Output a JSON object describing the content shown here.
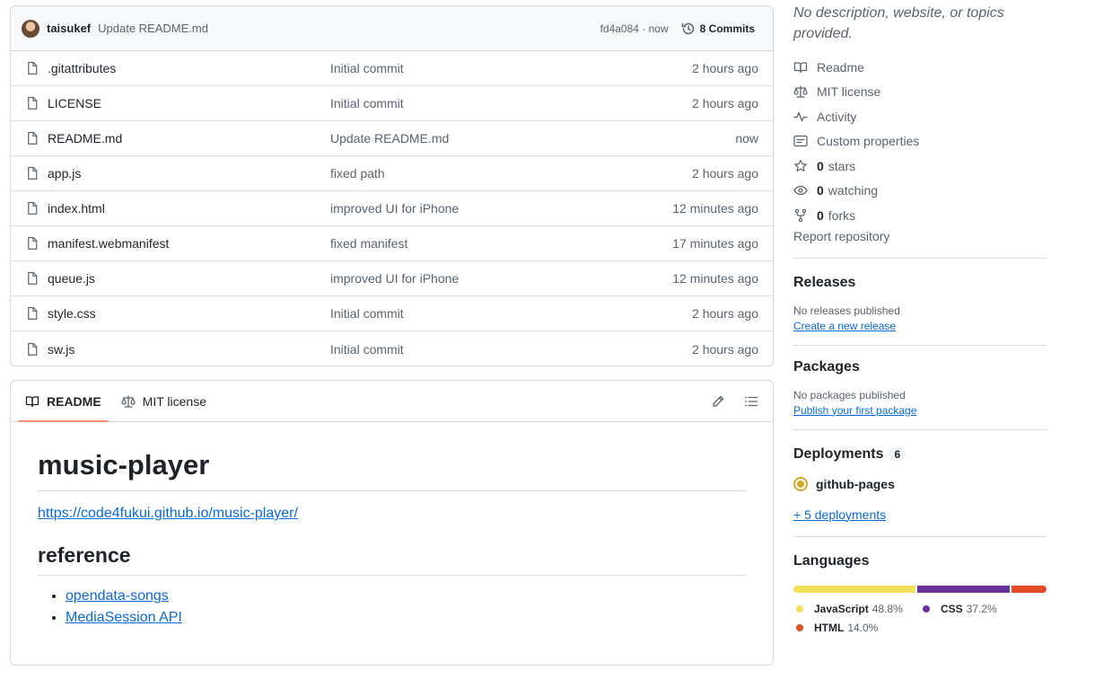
{
  "commit": {
    "author": "taisukef",
    "message": "Update README.md",
    "sha_time": "fd4a084 · now",
    "count_label": "8 Commits"
  },
  "files": [
    {
      "name": ".gitattributes",
      "commit": "Initial commit",
      "age": "2 hours ago"
    },
    {
      "name": "LICENSE",
      "commit": "Initial commit",
      "age": "2 hours ago"
    },
    {
      "name": "README.md",
      "commit": "Update README.md",
      "age": "now"
    },
    {
      "name": "app.js",
      "commit": "fixed path",
      "age": "2 hours ago"
    },
    {
      "name": "index.html",
      "commit": "improved UI for iPhone",
      "age": "12 minutes ago"
    },
    {
      "name": "manifest.webmanifest",
      "commit": "fixed manifest",
      "age": "17 minutes ago"
    },
    {
      "name": "queue.js",
      "commit": "improved UI for iPhone",
      "age": "12 minutes ago"
    },
    {
      "name": "style.css",
      "commit": "Initial commit",
      "age": "2 hours ago"
    },
    {
      "name": "sw.js",
      "commit": "Initial commit",
      "age": "2 hours ago"
    }
  ],
  "readme": {
    "tabs": [
      "README",
      "MIT license"
    ],
    "title": "music-player",
    "link": "https://code4fukui.github.io/music-player/",
    "h2": "reference",
    "refs": [
      "opendata-songs",
      "MediaSession API"
    ]
  },
  "sidebar": {
    "description": "No description, website, or topics provided.",
    "about": {
      "readme": "Readme",
      "license": "MIT license",
      "activity": "Activity",
      "custom": "Custom properties",
      "stars_count": "0",
      "stars_label": "stars",
      "watching_count": "0",
      "watching_label": "watching",
      "forks_count": "0",
      "forks_label": "forks"
    },
    "report": "Report repository",
    "releases": {
      "title": "Releases",
      "sub": "No releases published",
      "link": "Create a new release"
    },
    "packages": {
      "title": "Packages",
      "sub": "No packages published",
      "link": "Publish your first package"
    },
    "deployments": {
      "title": "Deployments",
      "count": "6",
      "item": "github-pages",
      "more": "+ 5 deployments"
    },
    "languages": {
      "title": "Languages",
      "items": [
        {
          "name": "JavaScript",
          "pct": "48.8%",
          "value": 48.8,
          "color": "#f1e05a"
        },
        {
          "name": "CSS",
          "pct": "37.2%",
          "value": 37.2,
          "color": "#663399"
        },
        {
          "name": "HTML",
          "pct": "14.0%",
          "value": 14.0,
          "color": "#e34c26"
        }
      ]
    }
  }
}
